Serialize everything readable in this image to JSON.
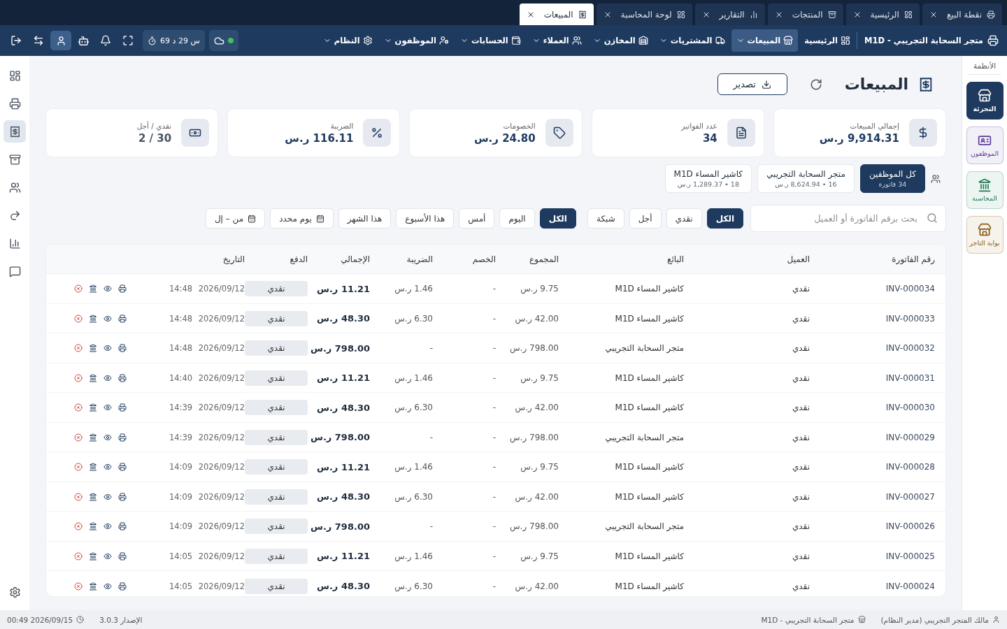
{
  "tabs": [
    {
      "label": "نقطة البيع",
      "selected": false
    },
    {
      "label": "الرئيسية",
      "selected": false
    },
    {
      "label": "المنتجات",
      "selected": false
    },
    {
      "label": "التقارير",
      "selected": false
    },
    {
      "label": "لوحة المحاسبة",
      "selected": false
    },
    {
      "label": "المبيعات",
      "selected": true
    }
  ],
  "navbar": {
    "brand": "متجر السحابة التجريبي - M1D",
    "items": [
      {
        "label": "الرئيسية",
        "has_menu": false,
        "selected": false
      },
      {
        "label": "المبيعات",
        "has_menu": true,
        "selected": true
      },
      {
        "label": "المشتريات",
        "has_menu": true,
        "selected": false
      },
      {
        "label": "المخازن",
        "has_menu": true,
        "selected": false
      },
      {
        "label": "العملاء",
        "has_menu": true,
        "selected": false
      },
      {
        "label": "الحسابات",
        "has_menu": true,
        "selected": false
      },
      {
        "label": "الموظفون",
        "has_menu": true,
        "selected": false
      },
      {
        "label": "النظام",
        "has_menu": true,
        "selected": false
      }
    ],
    "online": true,
    "uptime": "69 س 29 د",
    "user_menu_active": true
  },
  "systems_sidebar": {
    "title": "الأنظمة",
    "items": [
      {
        "label": "التجزئة",
        "selected": true,
        "color": "#1e3a5f"
      },
      {
        "label": "الموظفون",
        "selected": false,
        "color": "#5b3b9a"
      },
      {
        "label": "المحاسبة",
        "selected": false,
        "color": "#1f7a55"
      },
      {
        "label": "بوابة التاجر",
        "selected": false,
        "color": "#8a5a12"
      }
    ]
  },
  "icon_rail": [
    {
      "selected": false
    },
    {
      "selected": false
    },
    {
      "selected": true
    },
    {
      "selected": false
    },
    {
      "selected": false
    },
    {
      "selected": false
    },
    {
      "selected": false
    },
    {
      "selected": false
    }
  ],
  "page": {
    "title": "المبيعات",
    "export_button": "تصدير"
  },
  "stats": [
    {
      "label": "إجمالي المبيعات",
      "value": "9,914.31 ر.س",
      "kind": "amount"
    },
    {
      "label": "عدد الفواتير",
      "value": "34",
      "kind": "amount"
    },
    {
      "label": "الخصومات",
      "value": "24.80 ر.س",
      "kind": "amount"
    },
    {
      "label": "الضريبة",
      "value": "116.11 ر.س",
      "kind": "amount"
    },
    {
      "label": "نقدي / أجل",
      "value": "30 / 2",
      "kind": "ratio"
    }
  ],
  "employee_filter": [
    {
      "name": "كل الموظفين",
      "detail": "34 فاتورة",
      "selected": true
    },
    {
      "name": "متجر السحابة التجريبي",
      "detail": "16 • 8,624.94 ر.س",
      "selected": false
    },
    {
      "name": "كاشير المساء M1D",
      "detail": "18 • 1,289.37 ر.س",
      "selected": false
    }
  ],
  "search": {
    "placeholder": "بحث برقم الفاتورة أو العميل"
  },
  "payment_filters": [
    {
      "label": "الكل",
      "selected": true
    },
    {
      "label": "نقدي",
      "selected": false
    },
    {
      "label": "أجل",
      "selected": false
    },
    {
      "label": "شبكة",
      "selected": false
    }
  ],
  "date_filters": [
    {
      "label": "الكل",
      "selected": true,
      "kind": "preset"
    },
    {
      "label": "اليوم",
      "selected": false,
      "kind": "preset"
    },
    {
      "label": "أمس",
      "selected": false,
      "kind": "preset"
    },
    {
      "label": "هذا الأسبوع",
      "selected": false,
      "kind": "preset"
    },
    {
      "label": "هذا الشهر",
      "selected": false,
      "kind": "preset"
    },
    {
      "label": "يوم محدد",
      "selected": false,
      "kind": "picker"
    },
    {
      "label": "من – إل",
      "selected": false,
      "kind": "picker"
    }
  ],
  "table": {
    "columns": [
      "رقم الفاتورة",
      "العميل",
      "البائع",
      "المجموع",
      "الخصم",
      "الضريبة",
      "الإجمالي",
      "الدفع",
      "التاريخ"
    ],
    "rows": [
      {
        "invoice": "INV-000034",
        "customer": "نقدي",
        "seller": "كاشير المساء M1D",
        "subtotal": "9.75 ر.س",
        "discount": "-",
        "tax": "1.46 ر.س",
        "total": "11.21 ر.س",
        "payment": "نقدي",
        "date": "2026/09/12 14:48"
      },
      {
        "invoice": "INV-000033",
        "customer": "نقدي",
        "seller": "كاشير المساء M1D",
        "subtotal": "42.00 ر.س",
        "discount": "-",
        "tax": "6.30 ر.س",
        "total": "48.30 ر.س",
        "payment": "نقدي",
        "date": "2026/09/12 14:48"
      },
      {
        "invoice": "INV-000032",
        "customer": "نقدي",
        "seller": "متجر السحابة التجريبي",
        "subtotal": "798.00 ر.س",
        "discount": "-",
        "tax": "-",
        "total": "798.00 ر.س",
        "payment": "نقدي",
        "date": "2026/09/12 14:48"
      },
      {
        "invoice": "INV-000031",
        "customer": "نقدي",
        "seller": "كاشير المساء M1D",
        "subtotal": "9.75 ر.س",
        "discount": "-",
        "tax": "1.46 ر.س",
        "total": "11.21 ر.س",
        "payment": "نقدي",
        "date": "2026/09/12 14:40"
      },
      {
        "invoice": "INV-000030",
        "customer": "نقدي",
        "seller": "كاشير المساء M1D",
        "subtotal": "42.00 ر.س",
        "discount": "-",
        "tax": "6.30 ر.س",
        "total": "48.30 ر.س",
        "payment": "نقدي",
        "date": "2026/09/12 14:39"
      },
      {
        "invoice": "INV-000029",
        "customer": "نقدي",
        "seller": "متجر السحابة التجريبي",
        "subtotal": "798.00 ر.س",
        "discount": "-",
        "tax": "-",
        "total": "798.00 ر.س",
        "payment": "نقدي",
        "date": "2026/09/12 14:39"
      },
      {
        "invoice": "INV-000028",
        "customer": "نقدي",
        "seller": "كاشير المساء M1D",
        "subtotal": "9.75 ر.س",
        "discount": "-",
        "tax": "1.46 ر.س",
        "total": "11.21 ر.س",
        "payment": "نقدي",
        "date": "2026/09/12 14:09"
      },
      {
        "invoice": "INV-000027",
        "customer": "نقدي",
        "seller": "كاشير المساء M1D",
        "subtotal": "42.00 ر.س",
        "discount": "-",
        "tax": "6.30 ر.س",
        "total": "48.30 ر.س",
        "payment": "نقدي",
        "date": "2026/09/12 14:09"
      },
      {
        "invoice": "INV-000026",
        "customer": "نقدي",
        "seller": "متجر السحابة التجريبي",
        "subtotal": "798.00 ر.س",
        "discount": "-",
        "tax": "-",
        "total": "798.00 ر.س",
        "payment": "نقدي",
        "date": "2026/09/12 14:09"
      },
      {
        "invoice": "INV-000025",
        "customer": "نقدي",
        "seller": "كاشير المساء M1D",
        "subtotal": "9.75 ر.س",
        "discount": "-",
        "tax": "1.46 ر.س",
        "total": "11.21 ر.س",
        "payment": "نقدي",
        "date": "2026/09/12 14:05"
      },
      {
        "invoice": "INV-000024",
        "customer": "نقدي",
        "seller": "كاشير المساء M1D",
        "subtotal": "42.00 ر.س",
        "discount": "-",
        "tax": "6.30 ر.س",
        "total": "48.30 ر.س",
        "payment": "نقدي",
        "date": "2026/09/12 14:05"
      }
    ]
  },
  "status_bar": {
    "user": "مالك المتجر التجريبي (مدير النظام)",
    "store": "متجر السحابة التجريبي - M1D",
    "version": "الإصدار 3.0.3",
    "datetime": "2026/09/15 00:49"
  }
}
